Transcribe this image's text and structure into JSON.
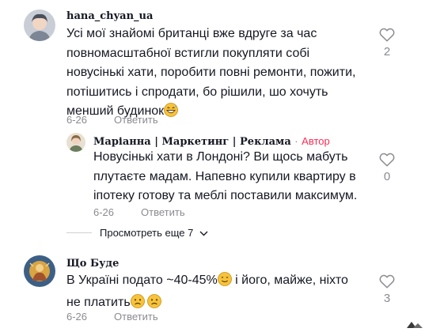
{
  "comments": [
    {
      "username": "hana_chyan_ua",
      "text": "Усі мої знайомі британці вже вдруге за час повномасштабної встигли покупляти собі новусінькі хати, поробити повні ремонти, пожити, потішитись і спродати, бо рішили, шо хочуть менший будинок",
      "text_emoji": "grinning-sweat-emoji",
      "date": "6-26",
      "reply_label": "Ответить",
      "likes": "2"
    },
    {
      "username": "Маріанна | Маркетинг | Реклама",
      "separator": "·",
      "author_label": "Автор",
      "text": "Новусінькі хати в Лондоні? Ви щось мабуть плутаєте мадам. Напевно купили квартиру в іпотеку готову та меблі поставили максимум.",
      "date": "6-26",
      "reply_label": "Ответить",
      "likes": "0"
    },
    {
      "username": "Що Буде",
      "text_before": "В Україні подато ~40-45%",
      "text_after": " і його, майже, ніхто не платить",
      "date": "6-26",
      "reply_label": "Ответить",
      "likes": "3"
    }
  ],
  "view_more": {
    "label": "Просмотреть еще 7"
  },
  "colors": {
    "author": "#fe2c55",
    "muted": "#8a8b91",
    "text": "#161823"
  }
}
